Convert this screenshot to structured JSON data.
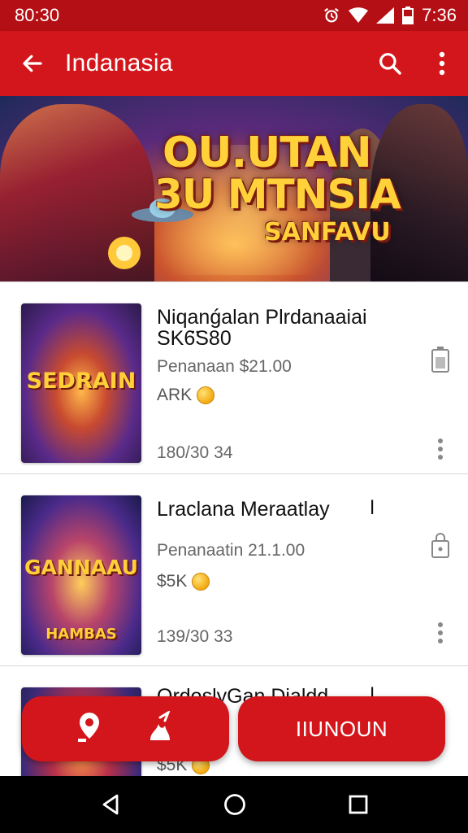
{
  "status_bar": {
    "time_left": "80:30",
    "time_right": "7:36"
  },
  "app_bar": {
    "title": "Indanasia"
  },
  "banner": {
    "line1": "OU.UTAN",
    "line2": "3U MTNSIA",
    "line3": "SANFAVU"
  },
  "items": [
    {
      "name_line1": "Niqanǵalan Plrdanaaiai",
      "name_line2": "SK6̈S80",
      "price": "Penanaan $21.00",
      "coins": "ARK",
      "meta": "180/30 34",
      "thumb_text": "SEDRAIN"
    },
    {
      "name_line1": "Lraclana Meraatlay",
      "price": "Penanaatin 21.1.00",
      "coins": "$5K",
      "meta": "139/30 33",
      "thumb_text": "GANNAAU",
      "thumb_sub": "HAMBAS"
    },
    {
      "name_line1": "OrdoslyGan Dialdd",
      "coins": "$5K"
    }
  ],
  "fab_right": {
    "label": "IIUNOUN"
  },
  "colors": {
    "primary": "#d3161b",
    "status": "#b40f14",
    "coin": "#f3a90f"
  }
}
